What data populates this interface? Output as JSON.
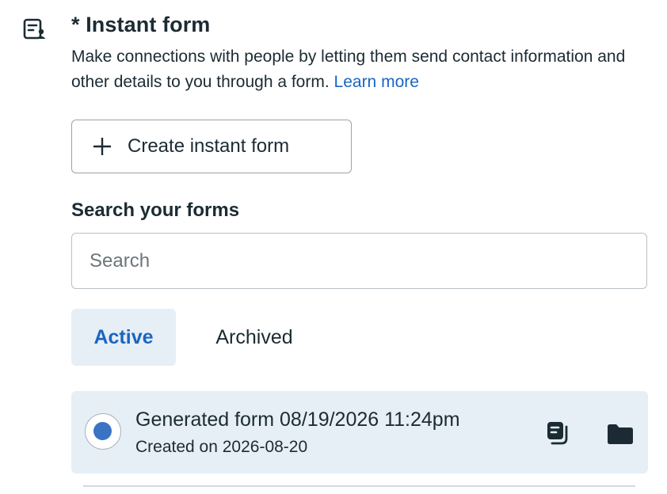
{
  "section": {
    "icon": "form-document-icon",
    "title": "* Instant form",
    "description": "Make connections with people by letting them send contact information and other details to you through a form.",
    "learn_more": "Learn more"
  },
  "create_button": {
    "icon": "plus-icon",
    "label": "Create instant form"
  },
  "search": {
    "heading": "Search your forms",
    "placeholder": "Search",
    "value": ""
  },
  "tabs": [
    {
      "label": "Active",
      "selected": true
    },
    {
      "label": "Archived",
      "selected": false
    }
  ],
  "forms": [
    {
      "name": "Generated form 08/19/2026 11:24pm",
      "created": "Created on 2026-08-20",
      "selected": true,
      "actions": [
        "duplicate-icon",
        "folder-icon"
      ]
    }
  ],
  "colors": {
    "accent": "#1a66c2",
    "selected_bg": "#e6eef6",
    "text": "#1c2b33",
    "radio_dot": "#3a73c4"
  }
}
